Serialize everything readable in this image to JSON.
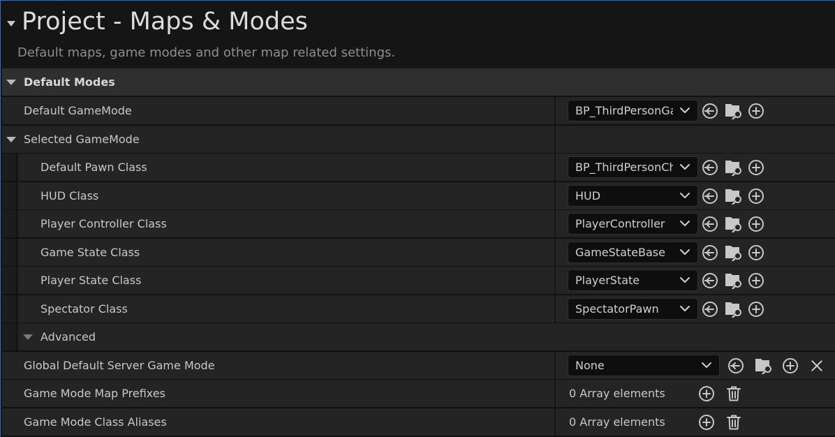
{
  "header": {
    "title": "Project - Maps & Modes",
    "subtitle": "Default maps, game modes and other map related settings."
  },
  "sections": {
    "default_modes": "Default Modes",
    "selected_gamemode": "Selected GameMode",
    "advanced": "Advanced"
  },
  "properties": {
    "default_gamemode": {
      "label": "Default GameMode",
      "value": "BP_ThirdPersonGa"
    },
    "default_pawn_class": {
      "label": "Default Pawn Class",
      "value": "BP_ThirdPersonCh"
    },
    "hud_class": {
      "label": "HUD Class",
      "value": "HUD"
    },
    "player_controller_class": {
      "label": "Player Controller Class",
      "value": "PlayerController"
    },
    "game_state_class": {
      "label": "Game State Class",
      "value": "GameStateBase"
    },
    "player_state_class": {
      "label": "Player State Class",
      "value": "PlayerState"
    },
    "spectator_class": {
      "label": "Spectator Class",
      "value": "SpectatorPawn"
    },
    "global_default_server_game_mode": {
      "label": "Global Default Server Game Mode",
      "value": "None"
    },
    "game_mode_map_prefixes": {
      "label": "Game Mode Map Prefixes",
      "value": "0 Array elements"
    },
    "game_mode_class_aliases": {
      "label": "Game Mode Class Aliases",
      "value": "0 Array elements"
    }
  },
  "icons": {
    "use_selected": "arrow-left-circle-icon",
    "browse": "folder-search-icon",
    "add": "plus-circle-icon",
    "clear": "close-icon",
    "delete": "trash-icon",
    "expand": "chevron-down-icon"
  },
  "colors": {
    "background": "#151515",
    "row": "#242424",
    "section_row": "#2f2f2f",
    "combo": "#0e0e0e",
    "text": "#c8c8c8",
    "accent_border": "#3c6fb0"
  }
}
